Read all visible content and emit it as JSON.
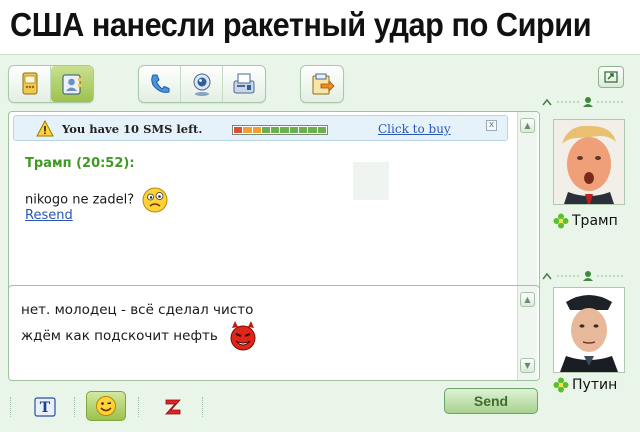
{
  "headline": "США нанесли ракетный удар по Сирии",
  "toolbar": {
    "groups": [
      [
        "sms-phone-icon",
        "contacts-book-icon"
      ],
      [
        "phone-call-icon",
        "webcam-icon",
        "fax-icon"
      ],
      [
        "file-transfer-icon"
      ]
    ],
    "active_button": "contacts-book-icon"
  },
  "sms_notice": {
    "text": "You have 10 SMS left.",
    "link": "Click to buy",
    "close": "x",
    "meter_cells": 10
  },
  "conversation": {
    "author": "Трамп (20:52):",
    "message": "nikogo ne zadel?",
    "resend": "Resend"
  },
  "compose": {
    "lines": [
      "нет. молодец - всё сделал чисто",
      "ждём как подскочит нефть"
    ]
  },
  "contacts": {
    "remote": {
      "name": "Трамп"
    },
    "local": {
      "name": "Путин"
    }
  },
  "bottom": {
    "text_format_glyph": "T",
    "send_label": "Send"
  },
  "colors": {
    "window_bg": "#eaf5ea",
    "author_green": "#3f9a24",
    "link_blue": "#2a56b4",
    "send_text": "#3d6e2c"
  }
}
